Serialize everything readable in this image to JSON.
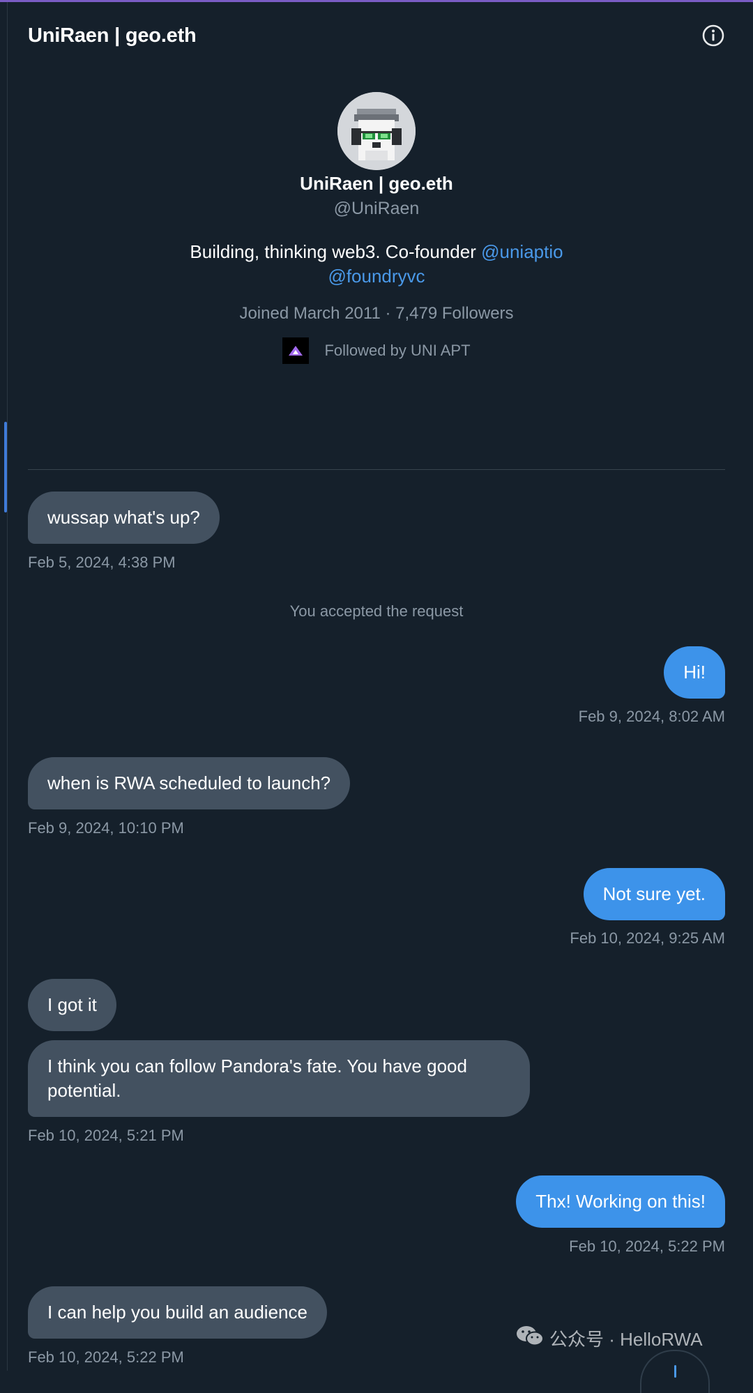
{
  "header": {
    "title": "UniRaen | geo.eth"
  },
  "profile": {
    "name": "UniRaen | geo.eth",
    "handle": "@UniRaen",
    "bio_text": "Building, thinking web3. Co-founder ",
    "bio_link1": "@uniaptio",
    "bio_link2": "@foundryvc",
    "meta": "Joined March 2011 · 7,479 Followers",
    "followed_by": "Followed by UNI APT"
  },
  "messages": {
    "m1": {
      "text": "wussap what's up?",
      "time": "Feb 5, 2024, 4:38 PM"
    },
    "system": "You accepted the request",
    "m2": {
      "text": "Hi!",
      "time": "Feb 9, 2024, 8:02 AM"
    },
    "m3": {
      "text": "when is RWA scheduled to launch?",
      "time": "Feb 9, 2024, 10:10 PM"
    },
    "m4": {
      "text": "Not sure yet.",
      "time": "Feb 10, 2024, 9:25 AM"
    },
    "m5": {
      "text": "I got it"
    },
    "m6": {
      "line1": "I think you can follow Pandora's fate. You have good",
      "line2": "potential.",
      "time": "Feb 10, 2024, 5:21 PM"
    },
    "m7": {
      "text": "Thx! Working on this!",
      "time": "Feb 10, 2024, 5:22 PM"
    },
    "m8": {
      "text": "I can help you build an audience",
      "time": "Feb 10, 2024, 5:22 PM"
    }
  },
  "watermark": {
    "text": "公众号 · HelloRWA"
  },
  "icons": {
    "info": "info-icon",
    "wechat": "wechat-icon",
    "scroll": "scroll-down-icon"
  },
  "colors": {
    "background": "#15202b",
    "incoming_bubble": "#435160",
    "outgoing_bubble": "#3d93ea",
    "link": "#4a99e9",
    "muted_text": "#8b98a5",
    "top_accent": "#7a5cc4"
  }
}
